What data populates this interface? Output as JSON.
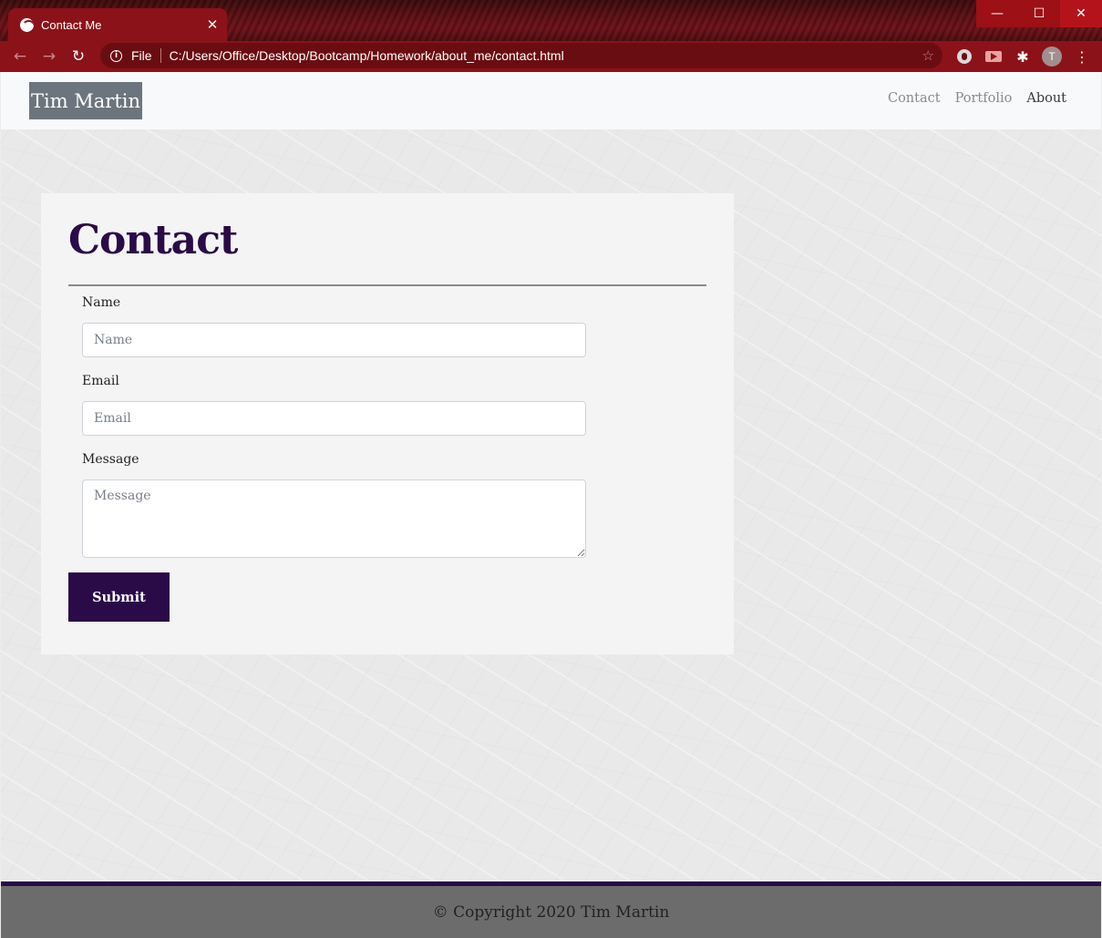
{
  "browser": {
    "tab_title": "Contact Me",
    "tab_close_icon": "close-icon",
    "window_controls": {
      "minimize": "—",
      "maximize": "☐",
      "close": "✕"
    },
    "back_icon": "←",
    "forward_icon": "→",
    "reload_icon": "↻",
    "omnibox_scheme": "File",
    "url": "C:/Users/Office/Desktop/Bootcamp/Homework/about_me/contact.html",
    "star_icon": "☆",
    "profile_initial": "T",
    "extensions_icon": "puzzle-icon",
    "menu_icon": "⋮",
    "accent_color": "#8c1219"
  },
  "site": {
    "brand": "Tim Martin",
    "nav": [
      {
        "label": "Contact",
        "active": false
      },
      {
        "label": "Portfolio",
        "active": false
      },
      {
        "label": "About",
        "active": true
      }
    ],
    "brand_color": "#2a0a47"
  },
  "contact": {
    "title": "Contact",
    "name_label": "Name",
    "name_placeholder": "Name",
    "email_label": "Email",
    "email_placeholder": "Email",
    "message_label": "Message",
    "message_placeholder": "Message",
    "submit_label": "Submit"
  },
  "footer": {
    "text": "© Copyright 2020 Tim Martin"
  }
}
